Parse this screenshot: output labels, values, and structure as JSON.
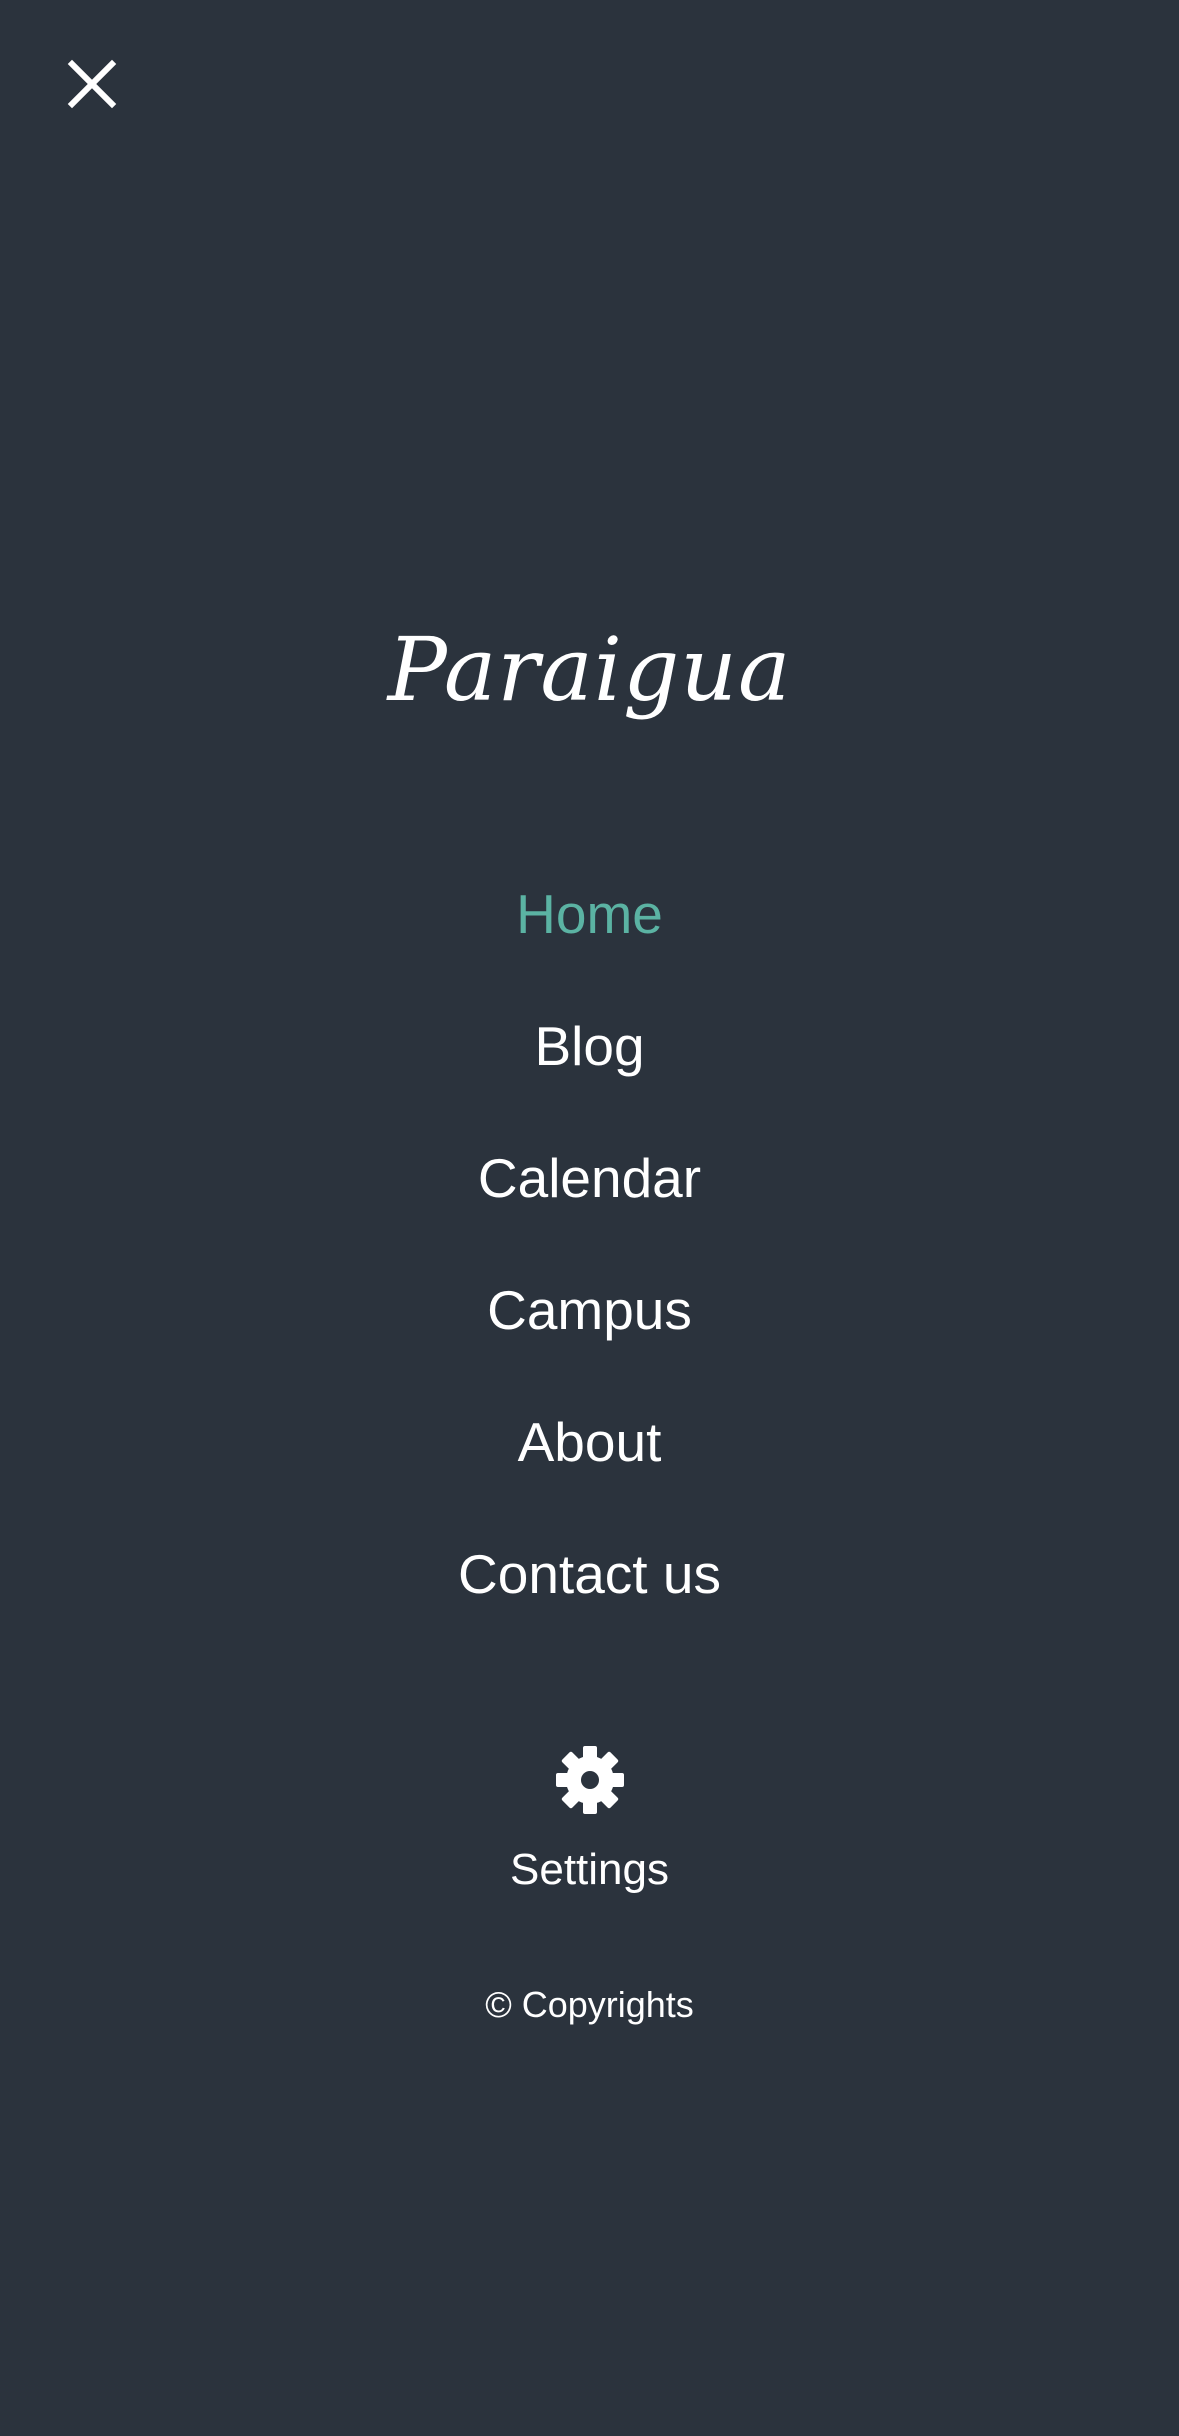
{
  "header": {
    "close_icon": "close-icon"
  },
  "brand": {
    "logo_text": "Paraigua"
  },
  "nav": {
    "items": [
      {
        "label": "Home",
        "active": true
      },
      {
        "label": "Blog",
        "active": false
      },
      {
        "label": "Calendar",
        "active": false
      },
      {
        "label": "Campus",
        "active": false
      },
      {
        "label": "About",
        "active": false
      },
      {
        "label": "Contact us",
        "active": false
      }
    ]
  },
  "settings": {
    "icon": "gear-icon",
    "label": "Settings"
  },
  "footer": {
    "copyright": "© Copyrights"
  },
  "colors": {
    "background": "#2b333d",
    "text": "#ffffff",
    "accent": "#5bb3a3"
  }
}
